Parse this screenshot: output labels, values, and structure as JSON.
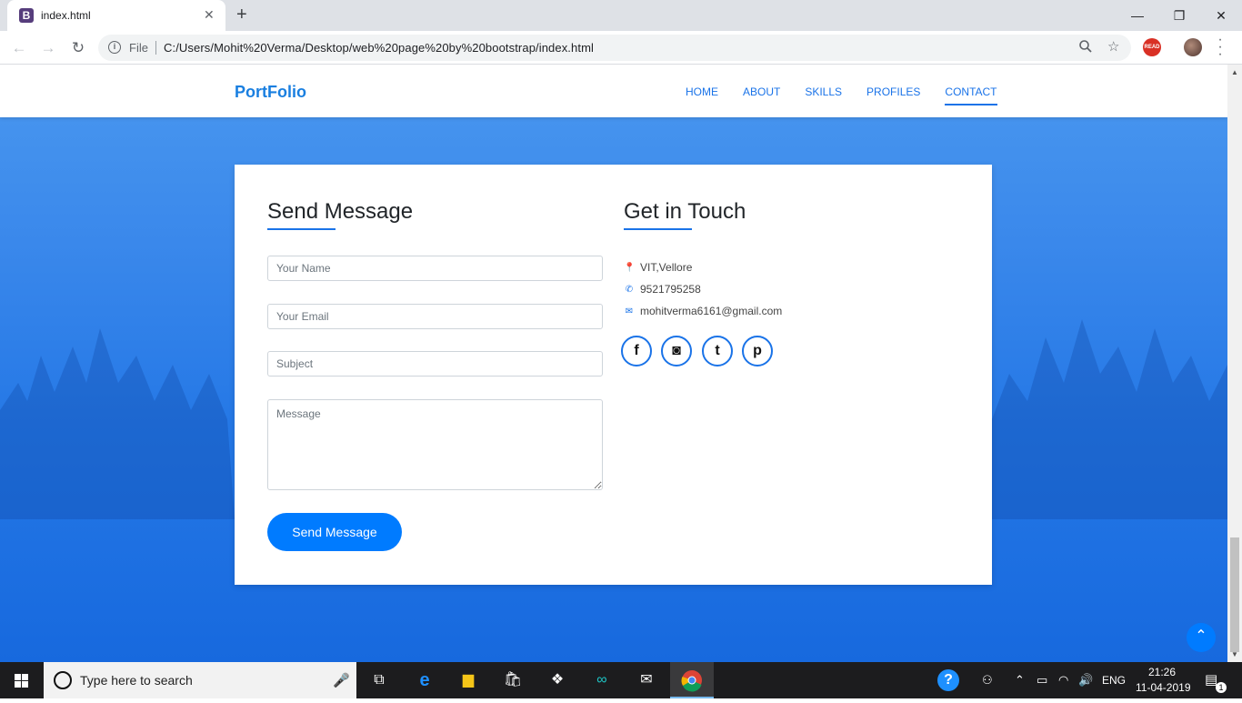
{
  "browser": {
    "tab_title": "index.html",
    "tab_favicon_letter": "B",
    "tab_close": "✕",
    "new_tab": "+",
    "min": "—",
    "restore": "❐",
    "close": "✕",
    "file_label": "File",
    "url": "C:/Users/Mohit%20Verma/Desktop/web%20page%20by%20bootstrap/index.html",
    "ext_read_label": "READ"
  },
  "site": {
    "brand": "PortFolio",
    "nav": [
      "HOME",
      "ABOUT",
      "SKILLS",
      "PROFILES",
      "CONTACT"
    ],
    "active_nav": "CONTACT"
  },
  "form": {
    "title": "Send Message",
    "name_placeholder": "Your Name",
    "email_placeholder": "Your Email",
    "subject_placeholder": "Subject",
    "message_placeholder": "Message",
    "submit_label": "Send Message"
  },
  "contact": {
    "title": "Get in Touch",
    "location": "VIT,Vellore",
    "phone": "9521795258",
    "email": "mohitverma6161@gmail.com",
    "social": [
      "f",
      "◙",
      "t",
      "p"
    ]
  },
  "taskbar": {
    "search_placeholder": "Type here to search",
    "lang": "ENG",
    "time": "21:26",
    "date": "11-04-2019",
    "notifications": "1"
  },
  "colors": {
    "accent": "#1a73e8",
    "button": "#007bff",
    "background_top": "#4a98ef",
    "background_bottom": "#1769de"
  }
}
